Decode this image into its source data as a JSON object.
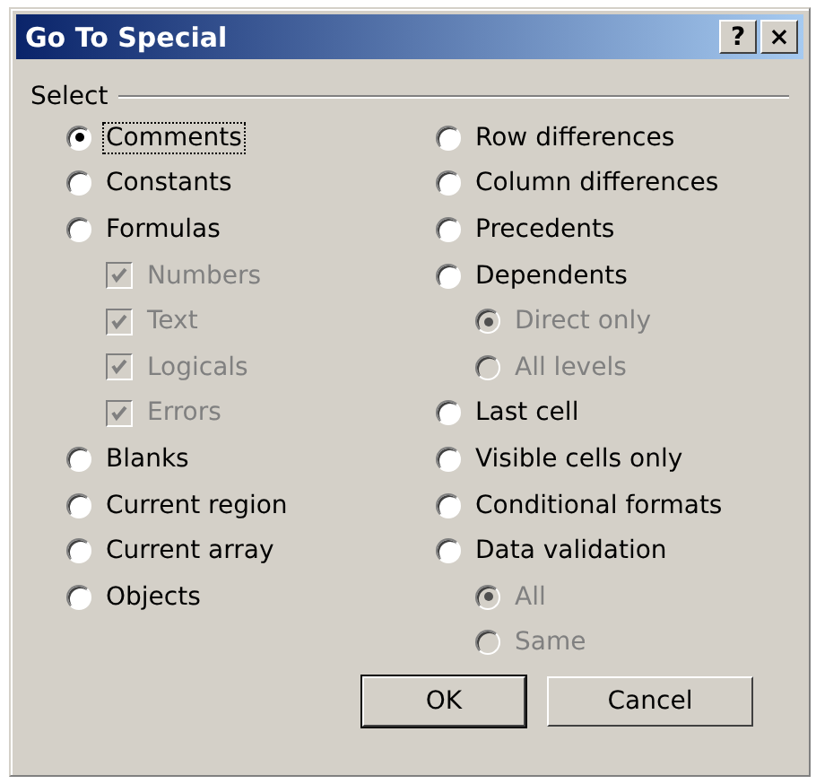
{
  "window": {
    "title": "Go To Special",
    "buttons": [
      "?",
      "×"
    ]
  },
  "group": {
    "label": "Select"
  },
  "columns": [
    [
      {
        "label": "Comments",
        "kind": "radio",
        "selected": true,
        "focused": true
      },
      {
        "label": "Constants",
        "kind": "radio",
        "selected": false
      },
      {
        "label": "Formulas",
        "kind": "radio",
        "selected": false,
        "children": [
          {
            "label": "Numbers",
            "kind": "checkbox",
            "checked": true,
            "disabled": true
          },
          {
            "label": "Text",
            "kind": "checkbox",
            "checked": true,
            "disabled": true
          },
          {
            "label": "Logicals",
            "kind": "checkbox",
            "checked": true,
            "disabled": true
          },
          {
            "label": "Errors",
            "kind": "checkbox",
            "checked": true,
            "disabled": true
          }
        ]
      },
      {
        "label": "Blanks",
        "kind": "radio",
        "selected": false
      },
      {
        "label": "Current region",
        "kind": "radio",
        "selected": false
      },
      {
        "label": "Current array",
        "kind": "radio",
        "selected": false
      },
      {
        "label": "Objects",
        "kind": "radio",
        "selected": false
      }
    ],
    [
      {
        "label": "Row differences",
        "kind": "radio",
        "selected": false
      },
      {
        "label": "Column differences",
        "kind": "radio",
        "selected": false
      },
      {
        "label": "Precedents",
        "kind": "radio",
        "selected": false
      },
      {
        "label": "Dependents",
        "kind": "radio",
        "selected": false,
        "children": [
          {
            "label": "Direct only",
            "kind": "radio",
            "selected": true,
            "disabled": true
          },
          {
            "label": "All levels",
            "kind": "radio",
            "selected": false,
            "disabled": true
          }
        ]
      },
      {
        "label": "Last cell",
        "kind": "radio",
        "selected": false
      },
      {
        "label": "Visible cells only",
        "kind": "radio",
        "selected": false
      },
      {
        "label": "Conditional formats",
        "kind": "radio",
        "selected": false
      },
      {
        "label": "Data validation",
        "kind": "radio",
        "selected": false,
        "children": [
          {
            "label": "All",
            "kind": "radio",
            "selected": true,
            "disabled": true
          },
          {
            "label": "Same",
            "kind": "radio",
            "selected": false,
            "disabled": true
          }
        ]
      }
    ]
  ],
  "buttons": [
    {
      "label": "OK",
      "default": true
    },
    {
      "label": "Cancel",
      "default": false
    }
  ]
}
